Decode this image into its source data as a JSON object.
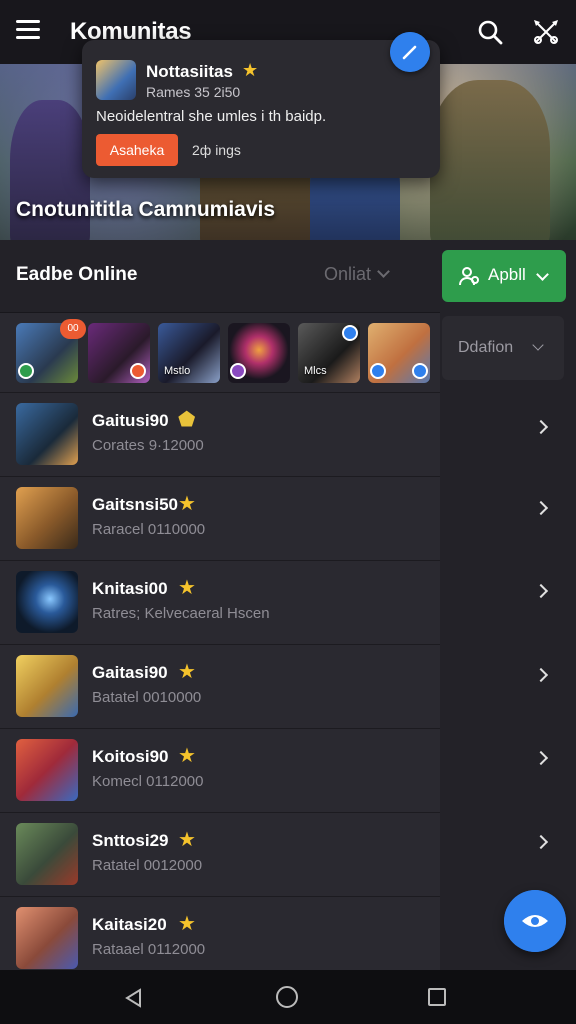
{
  "topbar": {
    "title": "Komunitas",
    "icons": [
      "menu-icon",
      "search-icon",
      "tools-icon"
    ]
  },
  "hero": {
    "title": "Cnotunititla Camnumiavis"
  },
  "notification": {
    "title": "Nottasiitas",
    "subtitle": "Rames 35 2i50",
    "message": "Neoidelentral she umles i th baidp.",
    "button_label": "Asaheka",
    "meta": "2ф ings"
  },
  "section": {
    "title": "Eadbe  Online",
    "filter_label": "Onliat"
  },
  "apply_button": {
    "label": "Apbll"
  },
  "donation": {
    "label": "Ddafion"
  },
  "strip": {
    "badge": "00",
    "captions": [
      "",
      "",
      "Mstlo",
      "",
      "Mlcs",
      ""
    ]
  },
  "list": [
    {
      "name": "Gaitusi90",
      "sub": "Corates 9·12000",
      "star": "🛡"
    },
    {
      "name": "Gaitsnsi50",
      "sub": "Raracel 0110000",
      "star": "★"
    },
    {
      "name": "Knitasi00",
      "sub": "Ratres; Kelvecaeral Hscen",
      "star": "★"
    },
    {
      "name": "Gaitasi90",
      "sub": "Batatel 0010000",
      "star": "★"
    },
    {
      "name": "Koitosi90",
      "sub": "Komecl 0112000",
      "star": "★"
    },
    {
      "name": "Snttosi29",
      "sub": "Ratatel 0012000",
      "star": "★"
    },
    {
      "name": "Kaitasi20",
      "sub": "Rataael 0112000",
      "star": "★"
    }
  ],
  "colors": {
    "accent_blue": "#2f80ed",
    "accent_green": "#2e9d4c",
    "accent_orange": "#ec5b32",
    "star": "#f5c32c"
  }
}
